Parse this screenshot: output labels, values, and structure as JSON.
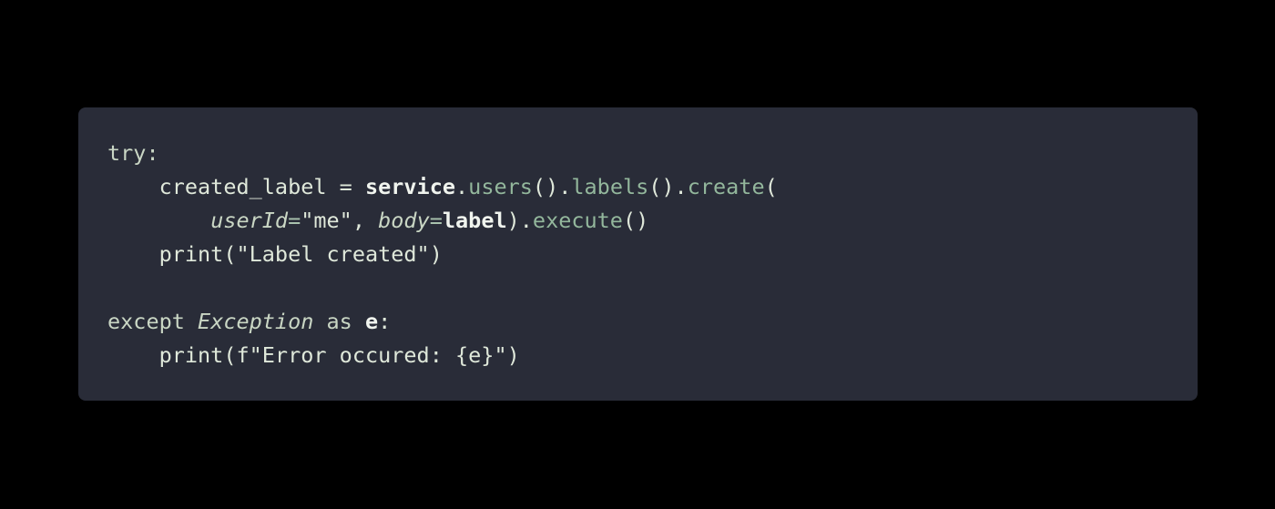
{
  "code": {
    "language": "python",
    "lines": [
      [
        {
          "t": "try:",
          "c": "kw"
        }
      ],
      [
        {
          "t": "    created_label = ",
          "c": ""
        },
        {
          "t": "service",
          "c": "b"
        },
        {
          "t": ".",
          "c": ""
        },
        {
          "t": "users",
          "c": "fn"
        },
        {
          "t": "().",
          "c": ""
        },
        {
          "t": "labels",
          "c": "fn"
        },
        {
          "t": "().",
          "c": ""
        },
        {
          "t": "create",
          "c": "fn"
        },
        {
          "t": "(",
          "c": ""
        }
      ],
      [
        {
          "t": "        ",
          "c": ""
        },
        {
          "t": "userId",
          "c": "it"
        },
        {
          "t": "=",
          "c": "op"
        },
        {
          "t": "\"me\", ",
          "c": ""
        },
        {
          "t": "body",
          "c": "it"
        },
        {
          "t": "=",
          "c": "op"
        },
        {
          "t": "label",
          "c": "b"
        },
        {
          "t": ").",
          "c": ""
        },
        {
          "t": "execute",
          "c": "fn"
        },
        {
          "t": "()",
          "c": ""
        }
      ],
      [
        {
          "t": "    print(\"Label created\")",
          "c": ""
        }
      ],
      [
        {
          "t": "",
          "c": ""
        }
      ],
      [
        {
          "t": "except ",
          "c": "kw"
        },
        {
          "t": "Exception",
          "c": "it"
        },
        {
          "t": " as ",
          "c": "kw"
        },
        {
          "t": "e",
          "c": "b"
        },
        {
          "t": ":",
          "c": ""
        }
      ],
      [
        {
          "t": "    print(f\"Error occured: {e}\")",
          "c": ""
        }
      ]
    ]
  }
}
